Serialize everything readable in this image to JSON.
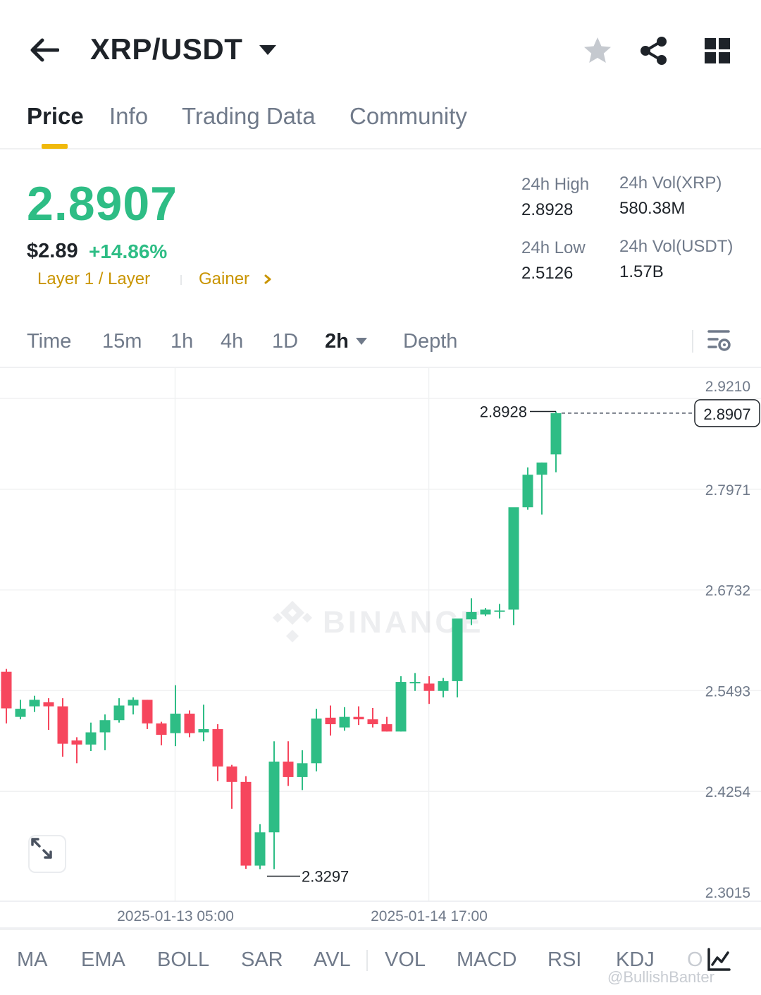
{
  "header": {
    "title": "XRP/USDT",
    "icons": [
      "back-arrow-icon",
      "caret-down-icon",
      "star-icon",
      "share-icon",
      "grid-icon"
    ]
  },
  "tabs": [
    {
      "label": "Price",
      "active": true
    },
    {
      "label": "Info",
      "active": false
    },
    {
      "label": "Trading Data",
      "active": false
    },
    {
      "label": "Community",
      "active": false
    }
  ],
  "ticker": {
    "last_price": "2.8907",
    "usd_price": "$2.89",
    "change_pct": "+14.86%",
    "tag_category": "Layer 1 / Layer",
    "tag_gainer": "Gainer"
  },
  "stats": {
    "high_label": "24h High",
    "high_value": "2.8928",
    "low_label": "24h Low",
    "low_value": "2.5126",
    "vol_base_label": "24h Vol(XRP)",
    "vol_base_value": "580.38M",
    "vol_quote_label": "24h Vol(USDT)",
    "vol_quote_value": "1.57B"
  },
  "intervals": [
    {
      "label": "Time",
      "active": false
    },
    {
      "label": "15m",
      "active": false
    },
    {
      "label": "1h",
      "active": false
    },
    {
      "label": "4h",
      "active": false
    },
    {
      "label": "1D",
      "active": false
    },
    {
      "label": "2h",
      "active": true
    },
    {
      "label": "Depth",
      "active": false
    }
  ],
  "chart_data": {
    "type": "candlestick",
    "interval": "2h",
    "y_ticks": [
      "2.9210",
      "2.7971",
      "2.6732",
      "2.5493",
      "2.4254",
      "2.3015"
    ],
    "ylim": [
      2.3015,
      2.921
    ],
    "x_ticks": [
      "2025-01-13 05:00",
      "2025-01-14 17:00"
    ],
    "last_price_label": "2.8907",
    "high_marker": "2.8928",
    "low_marker": "2.3297",
    "watermark": "BINANCE",
    "grid": true,
    "up_color": "#2ebd85",
    "down_color": "#f6465d",
    "candles": [
      {
        "o": 2.5725,
        "h": 2.576,
        "l": 2.509,
        "c": 2.5275
      },
      {
        "o": 2.517,
        "h": 2.538,
        "l": 2.514,
        "c": 2.527
      },
      {
        "o": 2.53,
        "h": 2.543,
        "l": 2.523,
        "c": 2.538
      },
      {
        "o": 2.535,
        "h": 2.54,
        "l": 2.501,
        "c": 2.53
      },
      {
        "o": 2.53,
        "h": 2.54,
        "l": 2.468,
        "c": 2.484
      },
      {
        "o": 2.488,
        "h": 2.492,
        "l": 2.46,
        "c": 2.483
      },
      {
        "o": 2.483,
        "h": 2.51,
        "l": 2.475,
        "c": 2.498
      },
      {
        "o": 2.498,
        "h": 2.52,
        "l": 2.476,
        "c": 2.513
      },
      {
        "o": 2.513,
        "h": 2.54,
        "l": 2.51,
        "c": 2.531
      },
      {
        "o": 2.531,
        "h": 2.541,
        "l": 2.52,
        "c": 2.538
      },
      {
        "o": 2.538,
        "h": 2.538,
        "l": 2.502,
        "c": 2.509
      },
      {
        "o": 2.509,
        "h": 2.511,
        "l": 2.482,
        "c": 2.495
      },
      {
        "o": 2.497,
        "h": 2.556,
        "l": 2.481,
        "c": 2.521
      },
      {
        "o": 2.521,
        "h": 2.525,
        "l": 2.492,
        "c": 2.497
      },
      {
        "o": 2.498,
        "h": 2.532,
        "l": 2.487,
        "c": 2.502
      },
      {
        "o": 2.502,
        "h": 2.508,
        "l": 2.438,
        "c": 2.456
      },
      {
        "o": 2.456,
        "h": 2.458,
        "l": 2.404,
        "c": 2.437
      },
      {
        "o": 2.437,
        "h": 2.444,
        "l": 2.33,
        "c": 2.334
      },
      {
        "o": 2.334,
        "h": 2.385,
        "l": 2.3297,
        "c": 2.375
      },
      {
        "o": 2.375,
        "h": 2.487,
        "l": 2.3297,
        "c": 2.462
      },
      {
        "o": 2.462,
        "h": 2.487,
        "l": 2.432,
        "c": 2.443
      },
      {
        "o": 2.443,
        "h": 2.476,
        "l": 2.427,
        "c": 2.46
      },
      {
        "o": 2.46,
        "h": 2.527,
        "l": 2.45,
        "c": 2.515
      },
      {
        "o": 2.516,
        "h": 2.531,
        "l": 2.494,
        "c": 2.508
      },
      {
        "o": 2.504,
        "h": 2.529,
        "l": 2.5,
        "c": 2.517
      },
      {
        "o": 2.517,
        "h": 2.53,
        "l": 2.507,
        "c": 2.514
      },
      {
        "o": 2.514,
        "h": 2.528,
        "l": 2.504,
        "c": 2.508
      },
      {
        "o": 2.508,
        "h": 2.517,
        "l": 2.499,
        "c": 2.499
      },
      {
        "o": 2.499,
        "h": 2.567,
        "l": 2.499,
        "c": 2.56
      },
      {
        "o": 2.56,
        "h": 2.571,
        "l": 2.549,
        "c": 2.56
      },
      {
        "o": 2.558,
        "h": 2.567,
        "l": 2.533,
        "c": 2.549
      },
      {
        "o": 2.549,
        "h": 2.565,
        "l": 2.541,
        "c": 2.561
      },
      {
        "o": 2.561,
        "h": 2.632,
        "l": 2.541,
        "c": 2.638
      },
      {
        "o": 2.637,
        "h": 2.663,
        "l": 2.63,
        "c": 2.646
      },
      {
        "o": 2.643,
        "h": 2.651,
        "l": 2.641,
        "c": 2.649
      },
      {
        "o": 2.648,
        "h": 2.656,
        "l": 2.638,
        "c": 2.648
      },
      {
        "o": 2.649,
        "h": 2.774,
        "l": 2.63,
        "c": 2.775
      },
      {
        "o": 2.775,
        "h": 2.824,
        "l": 2.772,
        "c": 2.815
      },
      {
        "o": 2.815,
        "h": 2.83,
        "l": 2.766,
        "c": 2.83
      },
      {
        "o": 2.84,
        "h": 2.8928,
        "l": 2.818,
        "c": 2.8907
      }
    ]
  },
  "indicators": [
    {
      "label": "MA"
    },
    {
      "label": "EMA"
    },
    {
      "label": "BOLL"
    },
    {
      "label": "SAR"
    },
    {
      "label": "AVL"
    },
    {
      "label": "VOL"
    },
    {
      "label": "MACD"
    },
    {
      "label": "RSI"
    },
    {
      "label": "KDJ"
    },
    {
      "label": "O"
    }
  ],
  "credit": "@BullishBanter"
}
